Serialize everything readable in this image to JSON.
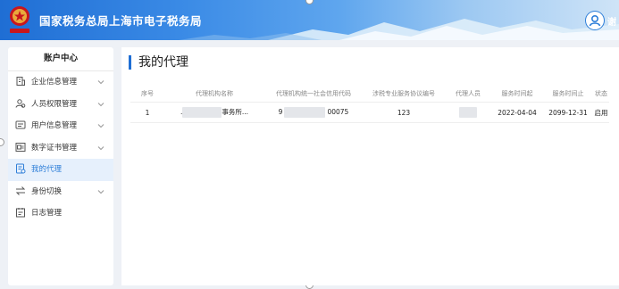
{
  "header": {
    "site_title": "国家税务总局上海市电子税务局",
    "user_suffix": "谢"
  },
  "sidebar": {
    "title": "账户中心",
    "items": [
      {
        "label": "企业信息管理",
        "icon": "building-icon",
        "has_arrow": true
      },
      {
        "label": "人员权限管理",
        "icon": "users-icon",
        "has_arrow": true
      },
      {
        "label": "用户信息管理",
        "icon": "user-card-icon",
        "has_arrow": true
      },
      {
        "label": "数字证书管理",
        "icon": "certificate-icon",
        "has_arrow": true
      },
      {
        "label": "我的代理",
        "icon": "agent-doc-icon",
        "has_arrow": false,
        "active": true
      },
      {
        "label": "身份切换",
        "icon": "switch-icon",
        "has_arrow": true
      },
      {
        "label": "日志管理",
        "icon": "log-icon",
        "has_arrow": false
      }
    ]
  },
  "main": {
    "page_title": "我的代理",
    "table": {
      "columns": [
        "序号",
        "代理机构名称",
        "代理机构统一社会信用代码",
        "涉税专业服务协议编号",
        "代理人员",
        "服务时间起",
        "服务时间止",
        "状态"
      ],
      "rows": [
        {
          "index": "1",
          "agency_name_prefix": ".",
          "agency_name_suffix": "事务所...",
          "credit_code_prefix": "9",
          "credit_code_suffix": "00075",
          "agreement_no": "123",
          "start": "2022-04-04",
          "end": "2099-12-31",
          "status": "启用"
        }
      ]
    }
  },
  "colors": {
    "accent": "#1f6ed4",
    "active_bg": "#e6f0fc"
  }
}
